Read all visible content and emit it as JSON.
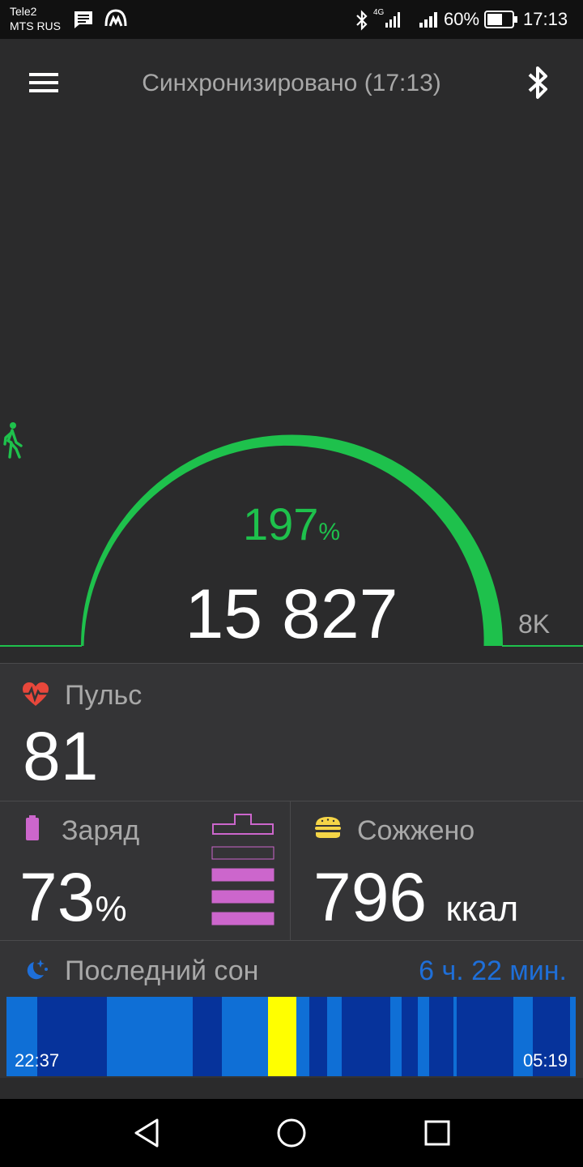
{
  "status_bar": {
    "carrier_1": "Tele2",
    "carrier_2": "MTS RUS",
    "network": "4G",
    "battery": "60%",
    "time": "17:13"
  },
  "header": {
    "sync_status": "Синхронизировано (17:13)",
    "menu_icon": "hamburger-menu-icon",
    "bluetooth_icon": "bluetooth-icon"
  },
  "steps": {
    "percent": "197",
    "percent_sign": "%",
    "count": "15 827",
    "goal": "8K",
    "progress_fraction": 1.0
  },
  "pulse": {
    "label": "Пульс",
    "value": "81"
  },
  "battery_card": {
    "label": "Заряд",
    "value": "73",
    "unit": "%",
    "level_fraction": 0.73
  },
  "burned": {
    "label": "Сожжено",
    "value": "796",
    "unit": "ккал"
  },
  "sleep": {
    "label": "Последний сон",
    "duration": "6 ч. 22 мин.",
    "start": "22:37",
    "end": "05:19",
    "stages": [
      "light",
      "deep",
      "light",
      "deep",
      "light",
      "awake",
      "light",
      "deep",
      "light",
      "deep",
      "light",
      "deep",
      "light",
      "deep",
      "light",
      "deep",
      "light",
      "deep",
      "light"
    ]
  },
  "colors": {
    "accent_green": "#1ec14c",
    "pulse_red": "#e8473b",
    "battery_purple": "#cc66cc",
    "burger_yellow": "#f5d547",
    "sleep_blue": "#1e6fd9",
    "sleep_light": "#0f6fd6",
    "sleep_deep": "#06339b",
    "sleep_awake": "#ffff00"
  }
}
